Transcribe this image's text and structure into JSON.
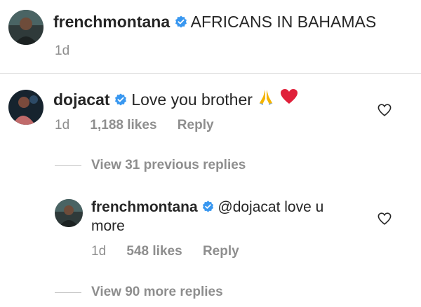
{
  "post": {
    "username": "frenchmontana",
    "caption": "AFRICANS IN BAHAMAS",
    "time": "1d"
  },
  "comment": {
    "username": "dojacat",
    "text": "Love you brother",
    "emojis": [
      "folded-hands-icon",
      "red-heart-icon"
    ],
    "time": "1d",
    "likes": "1,188 likes",
    "reply_label": "Reply",
    "view_previous": "View 31 previous replies"
  },
  "reply": {
    "username": "frenchmontana",
    "mention": "@dojacat",
    "text_line1": "love u",
    "text_line2": "more",
    "time": "1d",
    "likes": "548 likes",
    "reply_label": "Reply",
    "view_more": "View 90 more replies"
  },
  "colors": {
    "text": "#262626",
    "muted": "#8e8e8e",
    "verified": "#3897f0",
    "divider": "#dbdbdb"
  }
}
